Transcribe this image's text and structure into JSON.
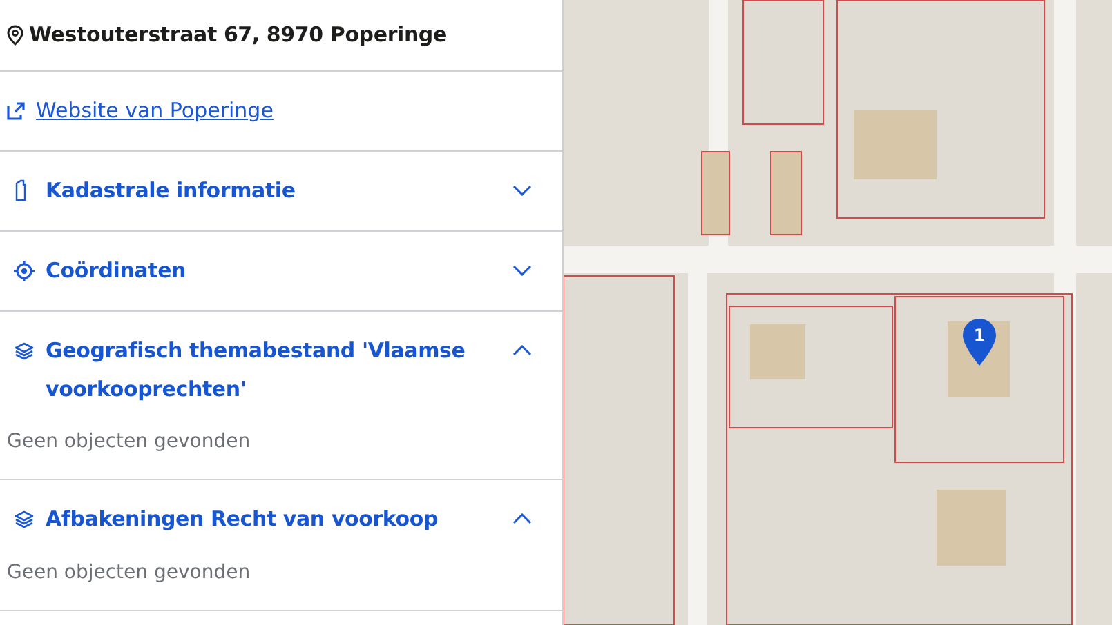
{
  "address": "Westouterstraat 67, 8970 Poperinge",
  "website_link": "Website van Poperinge",
  "sections": [
    {
      "kind": "cadastre",
      "title": "Kadastrale informatie",
      "expanded": false
    },
    {
      "kind": "target",
      "title": "Coördinaten",
      "expanded": false
    },
    {
      "kind": "layers",
      "title": "Geografisch themabestand 'Vlaamse voorkooprechten'",
      "expanded": true,
      "body": "Geen objecten gevonden"
    },
    {
      "kind": "layers",
      "title": "Afbakeningen Recht van voorkoop",
      "expanded": true,
      "body": "Geen objecten gevonden"
    }
  ],
  "map": {
    "kind": "picture",
    "marker": {
      "label": "1"
    }
  }
}
